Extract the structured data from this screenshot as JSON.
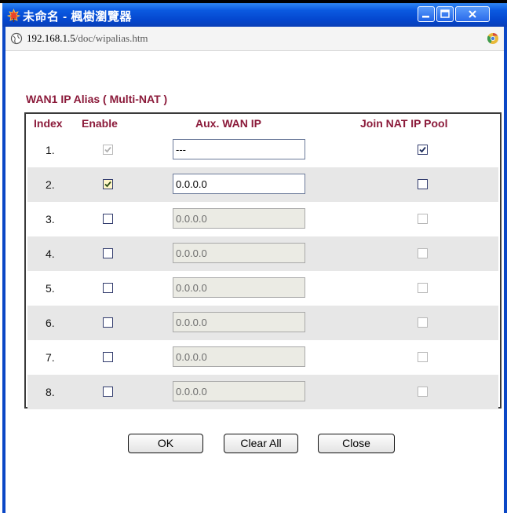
{
  "window": {
    "title": "未命名 - 楓樹瀏覽器",
    "controls": {
      "minimize_icon": "minimize-icon",
      "maximize_icon": "maximize-icon",
      "close_icon": "close-icon"
    }
  },
  "address_bar": {
    "host": "192.168.1.5",
    "path": "/doc/wipalias.htm"
  },
  "section_title": "WAN1 IP Alias ( Multi-NAT )",
  "table": {
    "headers": {
      "index": "Index",
      "enable": "Enable",
      "aux_wan_ip": "Aux. WAN IP",
      "join_nat": "Join NAT IP Pool"
    },
    "rows": [
      {
        "index": "1.",
        "enable": true,
        "enable_disabled": true,
        "ip": "---",
        "ip_disabled": false,
        "join": true,
        "join_disabled": false
      },
      {
        "index": "2.",
        "enable": true,
        "enable_disabled": false,
        "ip": "0.0.0.0",
        "ip_disabled": false,
        "join": false,
        "join_disabled": false
      },
      {
        "index": "3.",
        "enable": false,
        "enable_disabled": false,
        "ip": "0.0.0.0",
        "ip_disabled": true,
        "join": false,
        "join_disabled": true
      },
      {
        "index": "4.",
        "enable": false,
        "enable_disabled": false,
        "ip": "0.0.0.0",
        "ip_disabled": true,
        "join": false,
        "join_disabled": true
      },
      {
        "index": "5.",
        "enable": false,
        "enable_disabled": false,
        "ip": "0.0.0.0",
        "ip_disabled": true,
        "join": false,
        "join_disabled": true
      },
      {
        "index": "6.",
        "enable": false,
        "enable_disabled": false,
        "ip": "0.0.0.0",
        "ip_disabled": true,
        "join": false,
        "join_disabled": true
      },
      {
        "index": "7.",
        "enable": false,
        "enable_disabled": false,
        "ip": "0.0.0.0",
        "ip_disabled": true,
        "join": false,
        "join_disabled": true
      },
      {
        "index": "8.",
        "enable": false,
        "enable_disabled": false,
        "ip": "0.0.0.0",
        "ip_disabled": true,
        "join": false,
        "join_disabled": true
      }
    ]
  },
  "buttons": {
    "ok": "OK",
    "clear_all": "Clear All",
    "close": "Close"
  },
  "colors": {
    "title_bar": "#0b47c6",
    "section_text": "#8b1a3a",
    "row_shade": "#e7e7e7"
  }
}
